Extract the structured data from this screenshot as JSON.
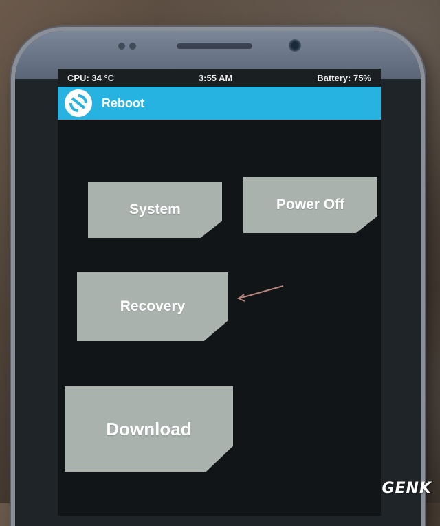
{
  "status": {
    "cpu": "CPU: 34 °C",
    "time": "3:55 AM",
    "battery": "Battery: 75%"
  },
  "header": {
    "title": "Reboot"
  },
  "buttons": {
    "system": "System",
    "power_off": "Power Off",
    "recovery": "Recovery",
    "download": "Download"
  },
  "watermark": "GENK",
  "icons": {
    "logo": "twrp-logo-icon",
    "arrow": "annotation-arrow"
  },
  "colors": {
    "header": "#27b3e2",
    "button": "#a9b2ad",
    "screen": "#121517"
  }
}
